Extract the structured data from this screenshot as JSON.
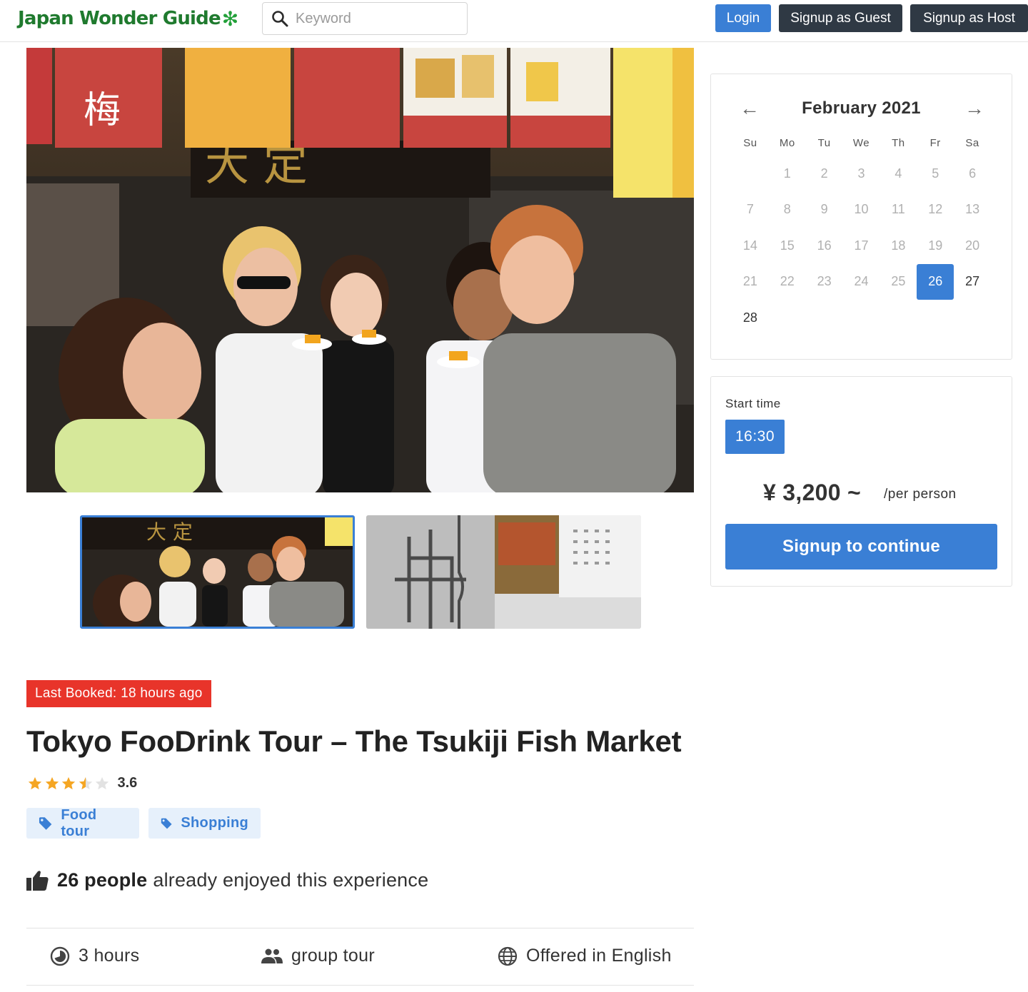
{
  "header": {
    "logo_text": "Japan Wonder Guide",
    "search_placeholder": "Keyword",
    "login_label": "Login",
    "signup_guest_label": "Signup as Guest",
    "signup_host_label": "Signup as Host"
  },
  "gallery": {
    "thumbnails": [
      "tour-photo-thumbnail",
      "market-photo-thumbnail"
    ]
  },
  "tour": {
    "last_booked": "Last Booked: 18 hours ago",
    "title": "Tokyo FooDrink Tour – The Tsukiji Fish Market",
    "rating": 3.6,
    "rating_text": "3.6",
    "tags": [
      "Food tour",
      "Shopping"
    ],
    "enjoyed_count": "26 people",
    "enjoyed_text": "already enjoyed this experience",
    "duration": "3 hours",
    "group_type": "group tour",
    "language": "Offered in English"
  },
  "calendar": {
    "month": "February 2021",
    "weekdays": [
      "Su",
      "Mo",
      "Tu",
      "We",
      "Th",
      "Fr",
      "Sa"
    ],
    "weeks": [
      [
        "",
        "1",
        "2",
        "3",
        "4",
        "5",
        "6"
      ],
      [
        "7",
        "8",
        "9",
        "10",
        "11",
        "12",
        "13"
      ],
      [
        "14",
        "15",
        "16",
        "17",
        "18",
        "19",
        "20"
      ],
      [
        "21",
        "22",
        "23",
        "24",
        "25",
        "26",
        "27"
      ],
      [
        "28",
        "",
        "",
        "",
        "",
        "",
        ""
      ]
    ],
    "selected_day": "26",
    "available_days": [
      "26",
      "27",
      "28"
    ]
  },
  "booking": {
    "start_time_label": "Start time",
    "start_time": "16:30",
    "price": "¥ 3,200 ~",
    "per_person": "/per person",
    "cta_label": "Signup to continue"
  },
  "colors": {
    "brand_green": "#1f7a2e",
    "primary_blue": "#3a7fd5",
    "dark_button": "#2f3944",
    "badge_red": "#e8342a",
    "tag_bg": "#e6f0fb",
    "star": "#f5a623"
  }
}
